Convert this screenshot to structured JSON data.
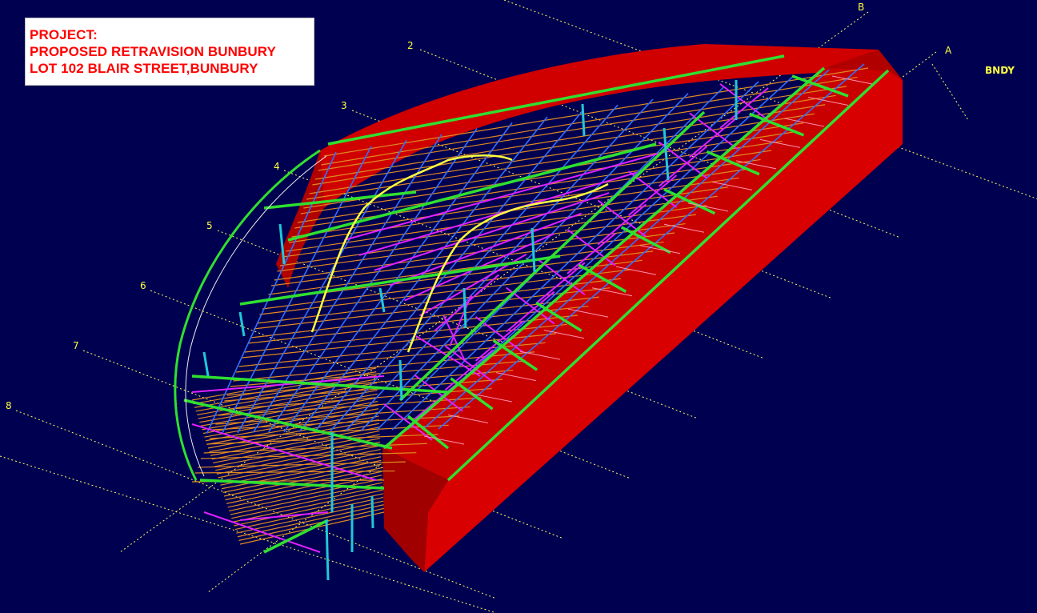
{
  "project": {
    "heading": "PROJECT:",
    "name": "PROPOSED RETRAVISION BUNBURY",
    "address": "LOT 102 BLAIR STREET,BUNBURY"
  },
  "grid_labels": {
    "b": "B",
    "a": "A",
    "bndy": "BNDY",
    "g2": "2",
    "g3": "3",
    "g4": "4",
    "g5": "5",
    "g6": "6",
    "g7": "7",
    "g8": "8"
  },
  "colors": {
    "background": "#000050",
    "wall": "#d00000",
    "wall_dark": "#8a0000",
    "grid_line": "#ffff60",
    "main_beam": "#30e030",
    "purlin": "#e08a20",
    "rafter_blue": "#3070ff",
    "bracing": "#e020ff",
    "column": "#20c8d8",
    "highlight": "#ffff40",
    "tie": "#ff90b0"
  }
}
